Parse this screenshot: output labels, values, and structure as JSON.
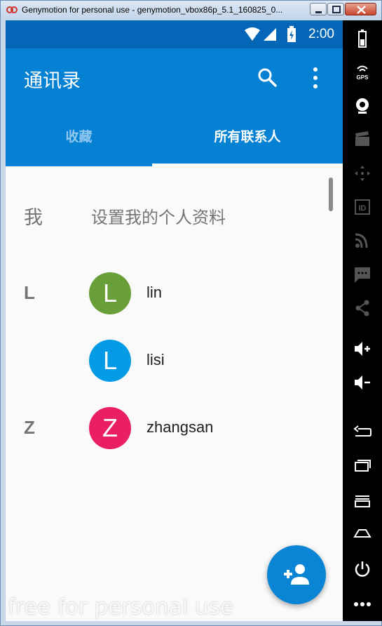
{
  "window": {
    "title": "Genymotion for personal use - genymotion_vbox86p_5.1_160825_0..."
  },
  "status_bar": {
    "time": "2:00"
  },
  "app_bar": {
    "title": "通讯录"
  },
  "tabs": [
    {
      "label": "收藏",
      "selected": false
    },
    {
      "label": "所有联系人",
      "selected": true
    }
  ],
  "me": {
    "letter": "我",
    "label": "设置我的个人资料"
  },
  "contacts": [
    {
      "section": "L",
      "initial": "L",
      "name": "lin",
      "color": "#689f38"
    },
    {
      "section": "",
      "initial": "L",
      "name": "lisi",
      "color": "#039be5"
    },
    {
      "section": "Z",
      "initial": "Z",
      "name": "zhangsan",
      "color": "#e91e63"
    }
  ],
  "watermark": "free for personal use",
  "sidebar_icons": [
    "battery-icon",
    "gps-icon",
    "webcam-icon",
    "movie-icon",
    "dpad-icon",
    "id-icon",
    "rss-icon",
    "sms-icon",
    "share-icon",
    "volume-up-icon",
    "volume-down-icon",
    "back-icon",
    "recent-apps-icon",
    "menu-icon",
    "home-icon",
    "power-icon",
    "more-icon"
  ],
  "colors": {
    "accent": "#0581d3",
    "statusbar": "#0366b6",
    "fab": "#0a85d6"
  }
}
